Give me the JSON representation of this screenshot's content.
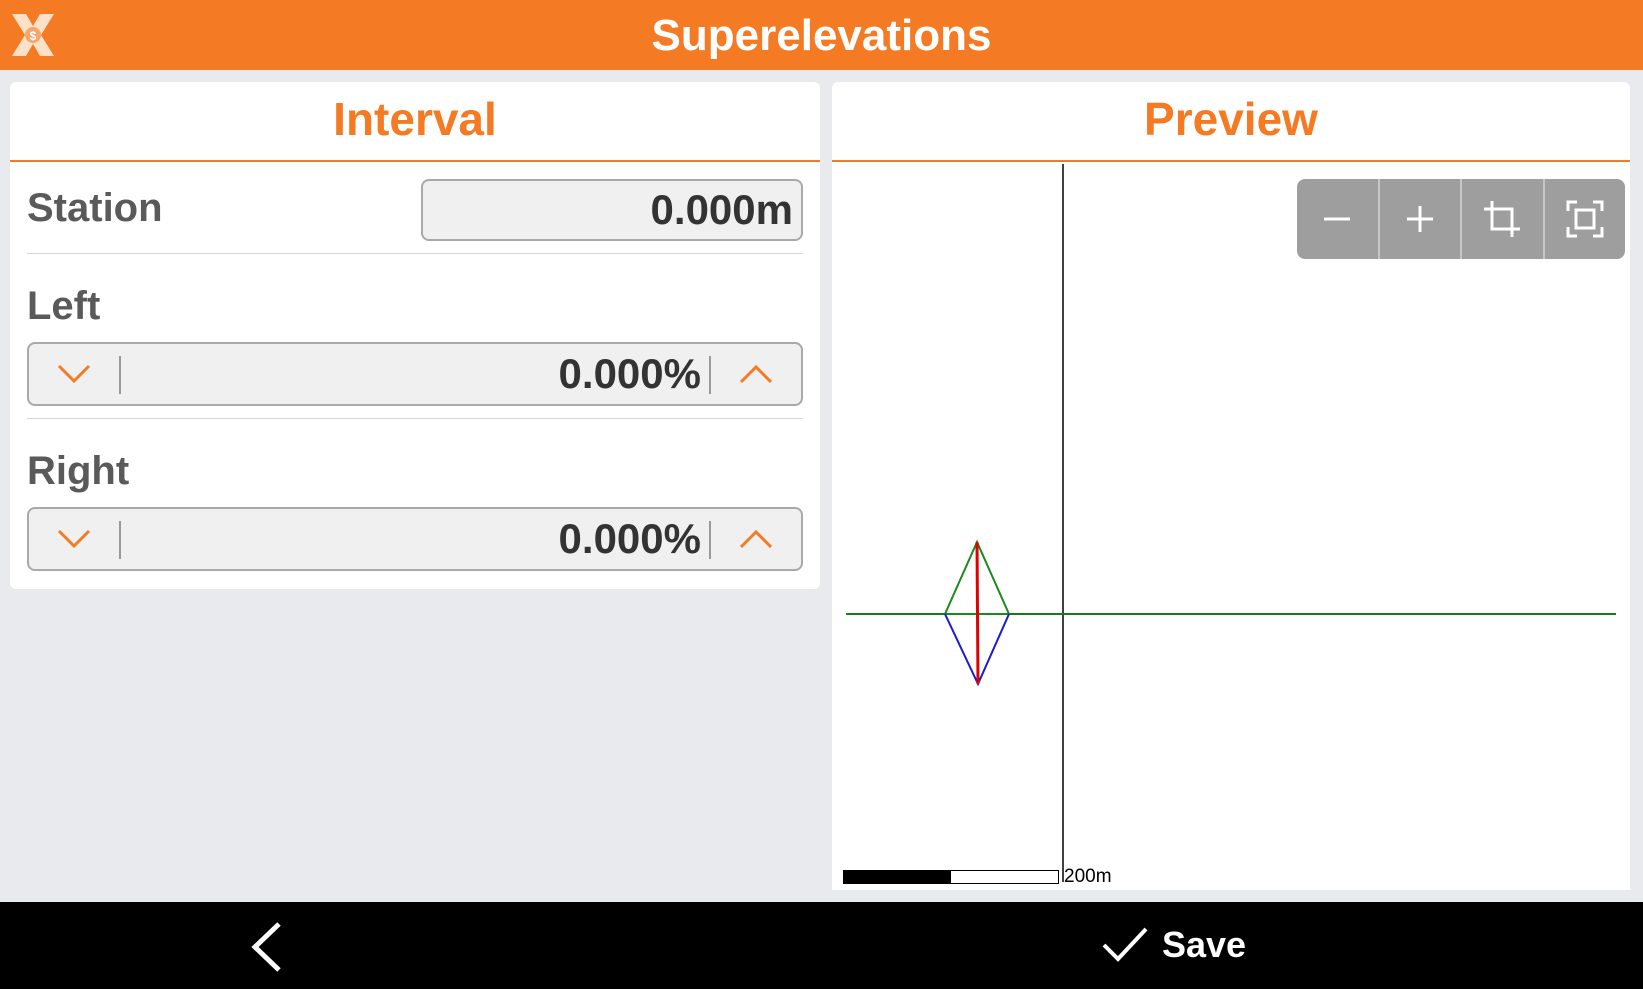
{
  "header": {
    "title": "Superelevations",
    "logo_icon": "x-logo-icon"
  },
  "colors": {
    "accent": "#f47a23",
    "header_bg": "#f47a23",
    "bottom_bar": "#000000"
  },
  "interval": {
    "title": "Interval",
    "station": {
      "label": "Station",
      "value": "0.000m"
    },
    "left": {
      "label": "Left",
      "value": "0.000%",
      "down_icon": "chevron-down-icon",
      "up_icon": "chevron-up-icon"
    },
    "right": {
      "label": "Right",
      "value": "0.000%",
      "down_icon": "chevron-down-icon",
      "up_icon": "chevron-up-icon"
    }
  },
  "preview": {
    "title": "Preview",
    "toolbar": [
      "zoom-out-icon",
      "zoom-in-icon",
      "crop-icon",
      "fit-extent-icon"
    ],
    "scale_label": "200m"
  },
  "footer": {
    "back_icon": "chevron-left-icon",
    "save_label": "Save",
    "save_icon": "check-icon"
  }
}
